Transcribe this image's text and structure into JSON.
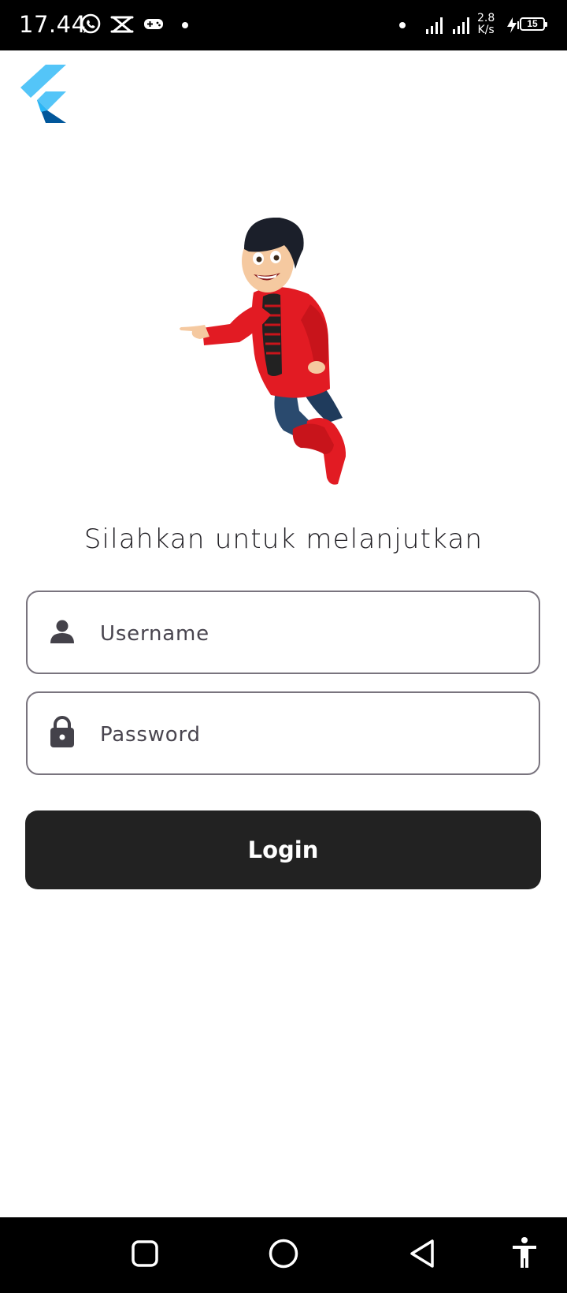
{
  "status_bar": {
    "time": "17.44",
    "icons": [
      "whatsapp-icon",
      "capcut-icon",
      "gamepad-icon",
      "dot-icon",
      "dot-icon",
      "signal-icon",
      "signal-icon",
      "charging-icon"
    ],
    "net_speed_value": "2.8",
    "net_speed_unit": "K/s",
    "battery_level": "15"
  },
  "app": {
    "logo": "flutter-logo",
    "hero_image": "cartoon-boy-flying-pointing",
    "prompt": "Silahkan untuk melanjutkan"
  },
  "form": {
    "username": {
      "icon": "person-icon",
      "placeholder": "Username",
      "value": ""
    },
    "password": {
      "icon": "lock-icon",
      "placeholder": "Password",
      "value": ""
    },
    "login_label": "Login"
  },
  "nav_bar": {
    "buttons": [
      "recents-square-icon",
      "home-circle-icon",
      "back-triangle-icon",
      "accessibility-icon"
    ]
  },
  "colors": {
    "accent": "#222222",
    "field_border": "#79747e",
    "flutter_light": "#54c5f8",
    "flutter_dark": "#01579b",
    "jacket_red": "#e21b23"
  }
}
